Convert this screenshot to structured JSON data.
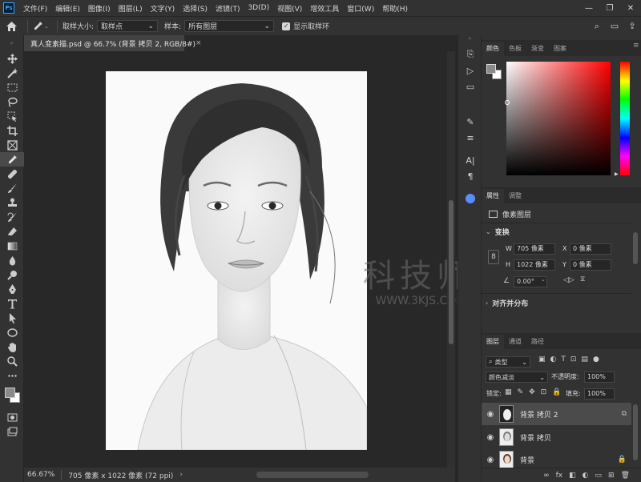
{
  "app": {
    "logo": "Ps"
  },
  "menu": [
    "文件(F)",
    "编辑(E)",
    "图像(I)",
    "图层(L)",
    "文字(Y)",
    "选择(S)",
    "滤镜(T)",
    "3D(D)",
    "视图(V)",
    "增效工具",
    "窗口(W)",
    "帮助(H)"
  ],
  "window_controls": [
    "—",
    "❐",
    "✕"
  ],
  "options": {
    "sample_size_label": "取样大小:",
    "sample_size_value": "取样点",
    "sample_label": "样本:",
    "sample_value": "所有图层",
    "show_ring_label": "显示取样环"
  },
  "document": {
    "tab_title": "真人变素描.psd @ 66.7% (背景 拷贝 2, RGB/8#)",
    "tab_close": "×",
    "zoom": "66.67%",
    "size_info": "705 像素 x 1022 像素 (72 ppi)"
  },
  "watermark": {
    "text": "科技师",
    "url": "WWW.3KJS.COM"
  },
  "color_panel": {
    "tabs": [
      "颜色",
      "色板",
      "渐变",
      "图案"
    ],
    "fg_color": "#8a8a8a",
    "bg_color": "#ffffff",
    "hue_color": "#ff0000"
  },
  "properties_panel": {
    "tabs": [
      "属性",
      "调整"
    ],
    "type": "像素图层",
    "transform_label": "变换",
    "w_label": "W",
    "w_value": "705 像素",
    "h_label": "H",
    "h_value": "1022 像素",
    "x_label": "X",
    "x_value": "0 像素",
    "y_label": "Y",
    "y_value": "0 像素",
    "angle_value": "0.00°",
    "align_label": "对齐并分布"
  },
  "layers_panel": {
    "tabs": [
      "图层",
      "通道",
      "路径"
    ],
    "filter_kind": "类型",
    "blend_mode": "颜色减淡",
    "opacity_label": "不透明度:",
    "opacity_value": "100%",
    "lock_label": "锁定:",
    "fill_label": "填充:",
    "fill_value": "100%",
    "layers": [
      {
        "name": "背景 拷贝 2",
        "selected": true
      },
      {
        "name": "背景 拷贝",
        "selected": false
      },
      {
        "name": "背景",
        "selected": false
      }
    ],
    "bottom_icons": [
      "∞",
      "fx",
      "◧",
      "◐",
      "▭",
      "⊞",
      "🗑"
    ]
  }
}
